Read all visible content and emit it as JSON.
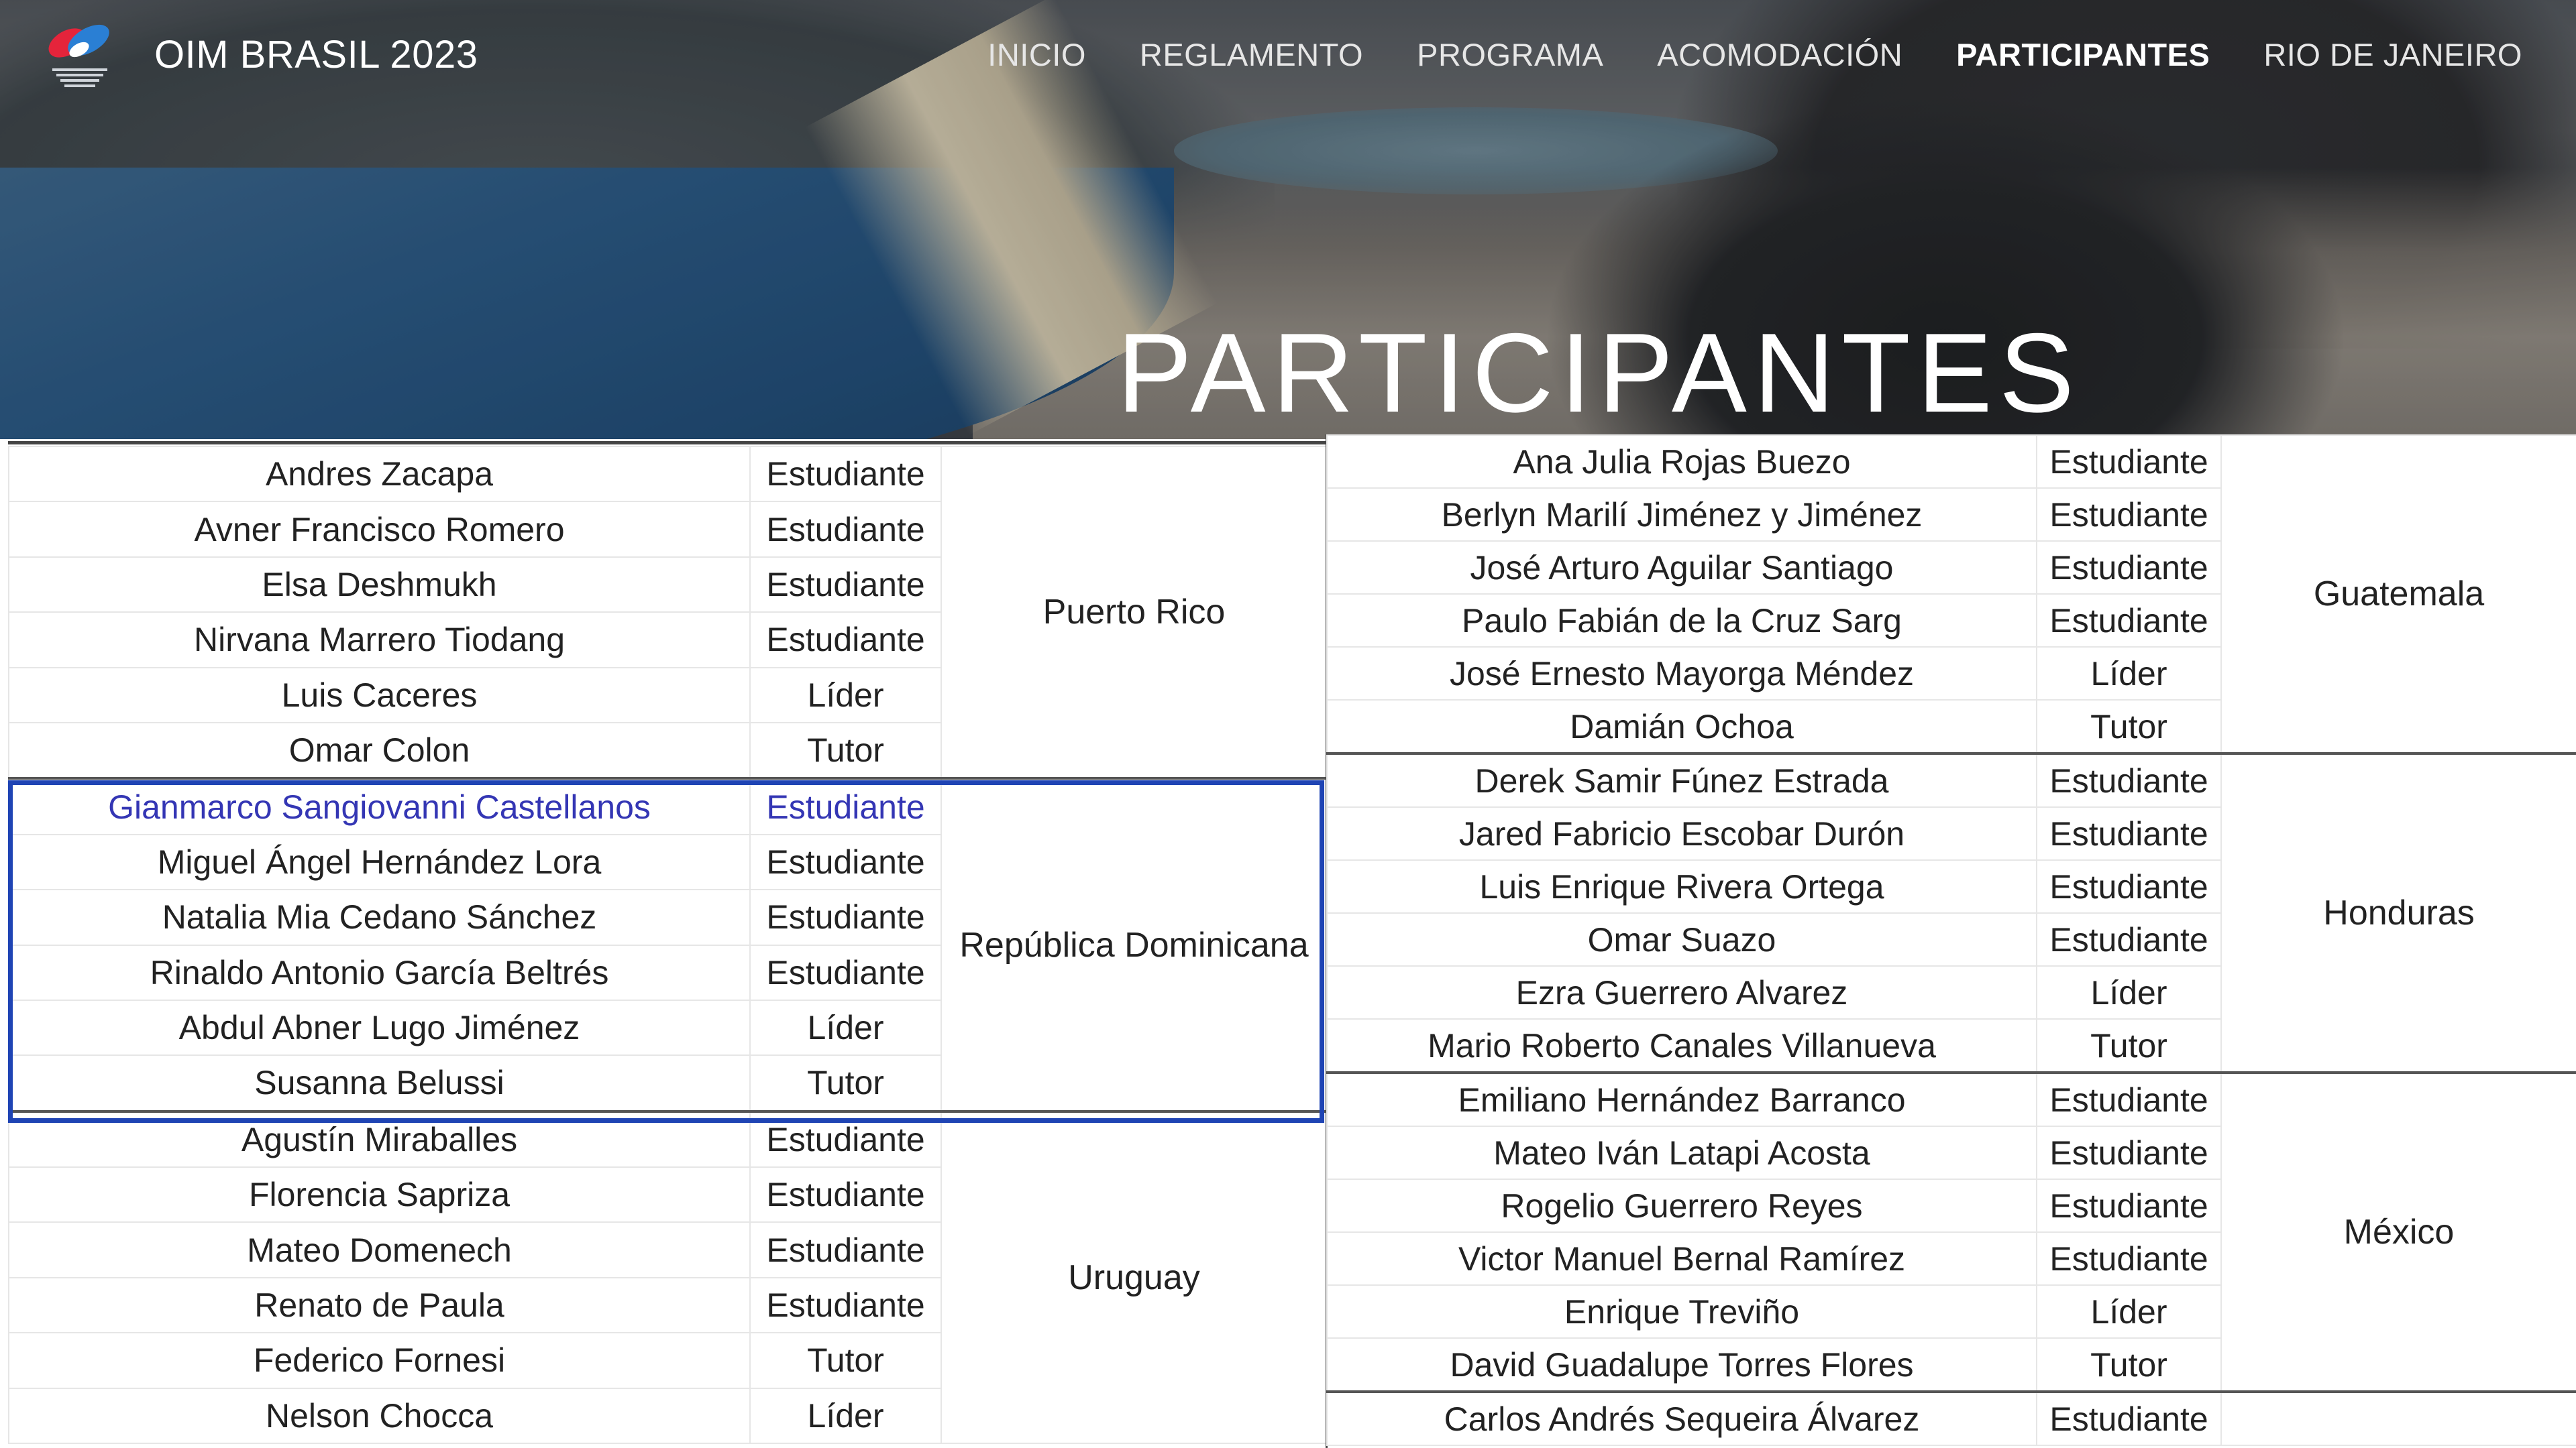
{
  "header": {
    "brand": "OIM BRASIL 2023",
    "nav": [
      {
        "label": "INICIO",
        "active": false
      },
      {
        "label": "REGLAMENTO",
        "active": false
      },
      {
        "label": "PROGRAMA",
        "active": false
      },
      {
        "label": "ACOMODACIÓN",
        "active": false
      },
      {
        "label": "PARTICIPANTES",
        "active": true
      },
      {
        "label": "RIO DE JANEIRO",
        "active": false
      }
    ],
    "page_title": "PARTICIPANTES"
  },
  "left_table": {
    "groups": [
      {
        "country": "Puerto Rico",
        "rows": [
          {
            "name": "Andres Zacapa",
            "role": "Estudiante"
          },
          {
            "name": "Avner Francisco Romero",
            "role": "Estudiante"
          },
          {
            "name": "Elsa Deshmukh",
            "role": "Estudiante"
          },
          {
            "name": "Nirvana Marrero Tiodang",
            "role": "Estudiante"
          },
          {
            "name": "Luis Caceres",
            "role": "Líder"
          },
          {
            "name": "Omar Colon",
            "role": "Tutor"
          }
        ]
      },
      {
        "country": "República Dominicana",
        "rows": [
          {
            "name": "Gianmarco Sangiovanni Castellanos",
            "role": "Estudiante",
            "link": true
          },
          {
            "name": "Miguel Ángel Hernández Lora",
            "role": "Estudiante"
          },
          {
            "name": "Natalia Mia Cedano Sánchez",
            "role": "Estudiante"
          },
          {
            "name": "Rinaldo Antonio García Beltrés",
            "role": "Estudiante"
          },
          {
            "name": "Abdul Abner Lugo Jiménez",
            "role": "Líder"
          },
          {
            "name": "Susanna Belussi",
            "role": "Tutor"
          }
        ]
      },
      {
        "country": "Uruguay",
        "rows": [
          {
            "name": "Agustín Miraballes",
            "role": "Estudiante"
          },
          {
            "name": "Florencia Sapriza",
            "role": "Estudiante"
          },
          {
            "name": "Mateo Domenech",
            "role": "Estudiante"
          },
          {
            "name": "Renato de Paula",
            "role": "Estudiante"
          },
          {
            "name": "Federico Fornesi",
            "role": "Tutor"
          },
          {
            "name": "Nelson Chocca",
            "role": "Líder"
          }
        ]
      }
    ]
  },
  "right_table": {
    "groups": [
      {
        "country": "Guatemala",
        "rows": [
          {
            "name": "Ana Julia Rojas Buezo",
            "role": "Estudiante"
          },
          {
            "name": "Berlyn Marilí Jiménez y Jiménez",
            "role": "Estudiante"
          },
          {
            "name": "José Arturo Aguilar Santiago",
            "role": "Estudiante"
          },
          {
            "name": "Paulo Fabián de la Cruz Sarg",
            "role": "Estudiante"
          },
          {
            "name": "José Ernesto Mayorga Méndez",
            "role": "Líder"
          },
          {
            "name": "Damián Ochoa",
            "role": "Tutor"
          }
        ]
      },
      {
        "country": "Honduras",
        "rows": [
          {
            "name": "Derek Samir Fúnez Estrada",
            "role": "Estudiante"
          },
          {
            "name": "Jared Fabricio Escobar Durón",
            "role": "Estudiante"
          },
          {
            "name": "Luis Enrique Rivera Ortega",
            "role": "Estudiante"
          },
          {
            "name": "Omar Suazo",
            "role": "Estudiante"
          },
          {
            "name": "Ezra Guerrero Alvarez",
            "role": "Líder"
          },
          {
            "name": "Mario Roberto Canales Villanueva",
            "role": "Tutor"
          }
        ]
      },
      {
        "country": "México",
        "rows": [
          {
            "name": "Emiliano Hernández Barranco",
            "role": "Estudiante"
          },
          {
            "name": "Mateo Iván Latapi Acosta",
            "role": "Estudiante"
          },
          {
            "name": "Rogelio Guerrero Reyes",
            "role": "Estudiante"
          },
          {
            "name": "Victor Manuel Bernal Ramírez",
            "role": "Estudiante"
          },
          {
            "name": "Enrique Treviño",
            "role": "Líder"
          },
          {
            "name": "David Guadalupe Torres Flores",
            "role": "Tutor"
          }
        ]
      },
      {
        "country": "",
        "rows": [
          {
            "name": "Carlos Andrés Sequeira Álvarez",
            "role": "Estudiante"
          }
        ]
      }
    ]
  },
  "colors": {
    "highlight": "#1f44b4",
    "link": "#3436b4"
  }
}
